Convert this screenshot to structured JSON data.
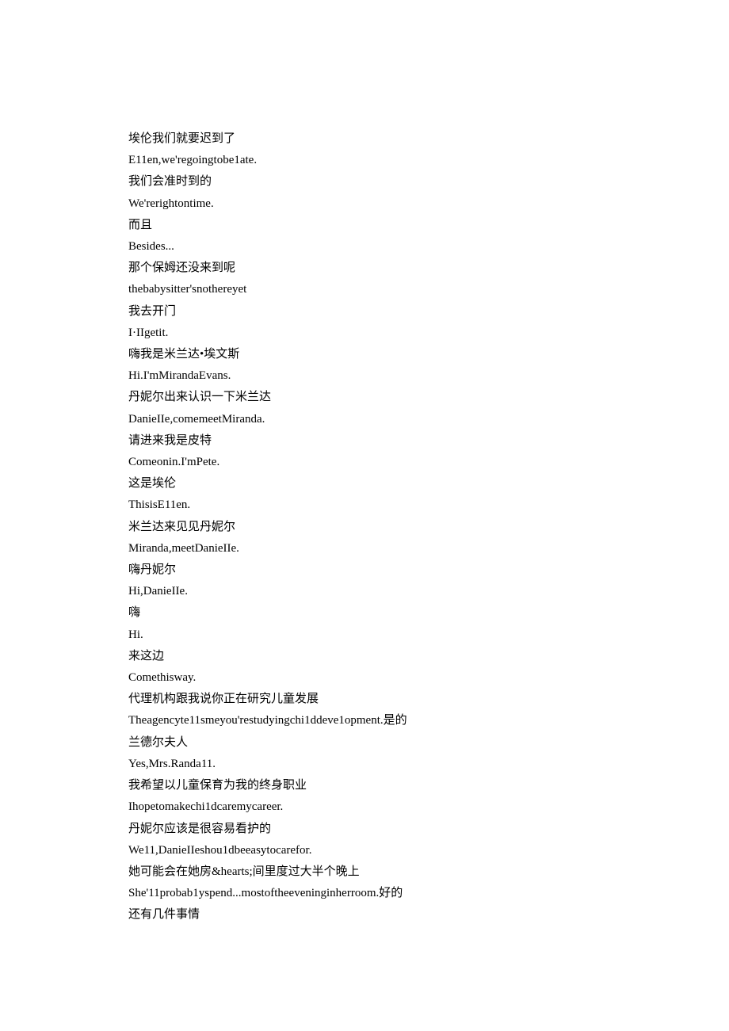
{
  "lines": [
    "埃伦我们就要迟到了",
    "E11en,we'regoingtobe1ate.",
    "我们会准时到的",
    "We'rerightontime.",
    "而且",
    "Besides...",
    "那个保姆还没来到呢",
    "thebabysitter'snothereyet",
    "我去开门",
    "I·IIgetit.",
    "嗨我是米兰达•埃文斯",
    "Hi.I'mMirandaEvans.",
    "丹妮尔出来认识一下米兰达",
    "DanieIIe,comemeetMiranda.",
    "请进来我是皮特",
    "Comeonin.I'mPete.",
    "这是埃伦",
    "ThisisE11en.",
    "米兰达来见见丹妮尔",
    "Miranda,meetDanieIIe.",
    "嗨丹妮尔",
    "Hi,DanieIIe.",
    "嗨",
    "Hi.",
    "来这边",
    "Comethisway.",
    "代理机构跟我说你正在研究儿童发展",
    "Theagencyte11smeyou'restudyingchi1ddeve1opment.是的",
    "兰德尔夫人",
    "Yes,Mrs.Randa11.",
    "我希望以儿童保育为我的终身职业",
    "Ihopetomakechi1dcaremycareer.",
    "丹妮尔应该是很容易看护的",
    "We11,DanieIIeshou1dbeeasytocarefor.",
    "她可能会在她房&hearts;间里度过大半个晚上",
    "She'11probab1yspend...mostoftheeveninginherroom.好的",
    "还有几件事情"
  ]
}
